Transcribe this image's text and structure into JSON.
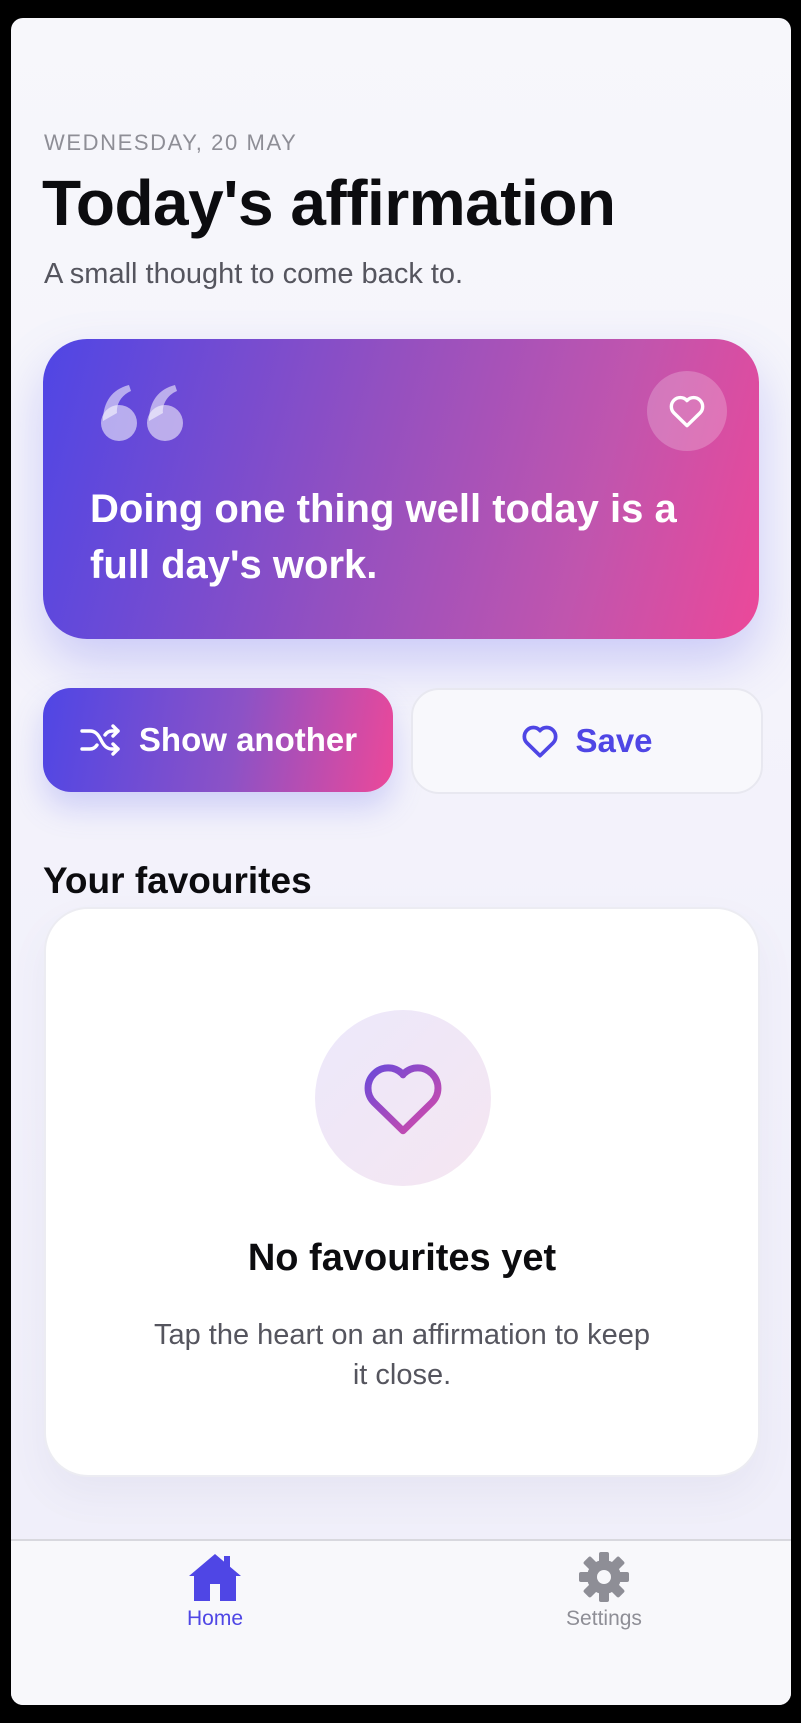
{
  "header": {
    "date": "WEDNESDAY, 20 MAY",
    "title": "Today's affirmation",
    "subtitle": "A small thought to come back to."
  },
  "affirmation": {
    "text": "Doing one thing well today is a full day's work."
  },
  "actions": {
    "show_another_label": "Show another",
    "save_label": "Save"
  },
  "favourites": {
    "section_title": "Your favourites",
    "empty_title": "No favourites yet",
    "empty_text": "Tap the heart on an affirmation to keep it close."
  },
  "tabbar": {
    "items": [
      {
        "label": "Home",
        "icon": "home-icon",
        "active": true
      },
      {
        "label": "Settings",
        "icon": "gear-icon",
        "active": false
      }
    ]
  },
  "colors": {
    "accent": "#4f46e5",
    "accent_pink": "#ec4899"
  }
}
